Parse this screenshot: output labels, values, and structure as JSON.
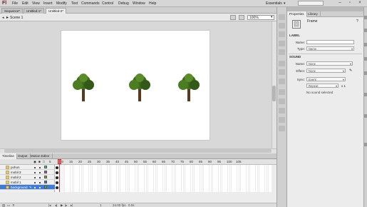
{
  "app": {
    "logo": "Fl"
  },
  "menu": [
    "File",
    "Edit",
    "View",
    "Insert",
    "Modify",
    "Text",
    "Commands",
    "Control",
    "Debug",
    "Window",
    "Help"
  ],
  "workspace": "Essentials",
  "doc_tabs": [
    "Sequence*",
    "Untitled-1*",
    "Untitled-2*"
  ],
  "scene": "Scene 1",
  "zoom": "100%",
  "timeline_tabs": [
    "Timeline",
    "Output",
    "Motion Editor"
  ],
  "ruler": [
    "5",
    "10",
    "15",
    "20",
    "25",
    "30",
    "35",
    "40",
    "45",
    "50",
    "55",
    "60",
    "65",
    "70",
    "75",
    "80",
    "85",
    "90",
    "95",
    "100",
    "105"
  ],
  "layers": [
    {
      "name": "pohon",
      "color": "#22c7b8",
      "selected": false
    },
    {
      "name": "mobil 3",
      "color": "#c740c7",
      "selected": false
    },
    {
      "name": "mobil 2",
      "color": "#c78a2a",
      "selected": false
    },
    {
      "name": "mobil 1",
      "color": "#2a8ac7",
      "selected": false
    },
    {
      "name": "background",
      "color": "#3ec73e",
      "selected": true
    }
  ],
  "timeline_footer": {
    "frame": "1",
    "fps": "24.00 fps",
    "time": "0.0s"
  },
  "properties": {
    "tabs": [
      "Properties",
      "Library"
    ],
    "type_title": "Frame",
    "label_section": "LABEL",
    "name_label": "Name:",
    "type_label": "Type:",
    "type_value": "Name",
    "sound_section": "SOUND",
    "sound_name_label": "Name:",
    "sound_name_value": "None",
    "effect_label": "Effect:",
    "effect_value": "None",
    "sync_label": "Sync:",
    "sync_value": "Event",
    "repeat_value": "Repeat",
    "repeat_count": "x 1",
    "no_sound": "No sound selected"
  }
}
